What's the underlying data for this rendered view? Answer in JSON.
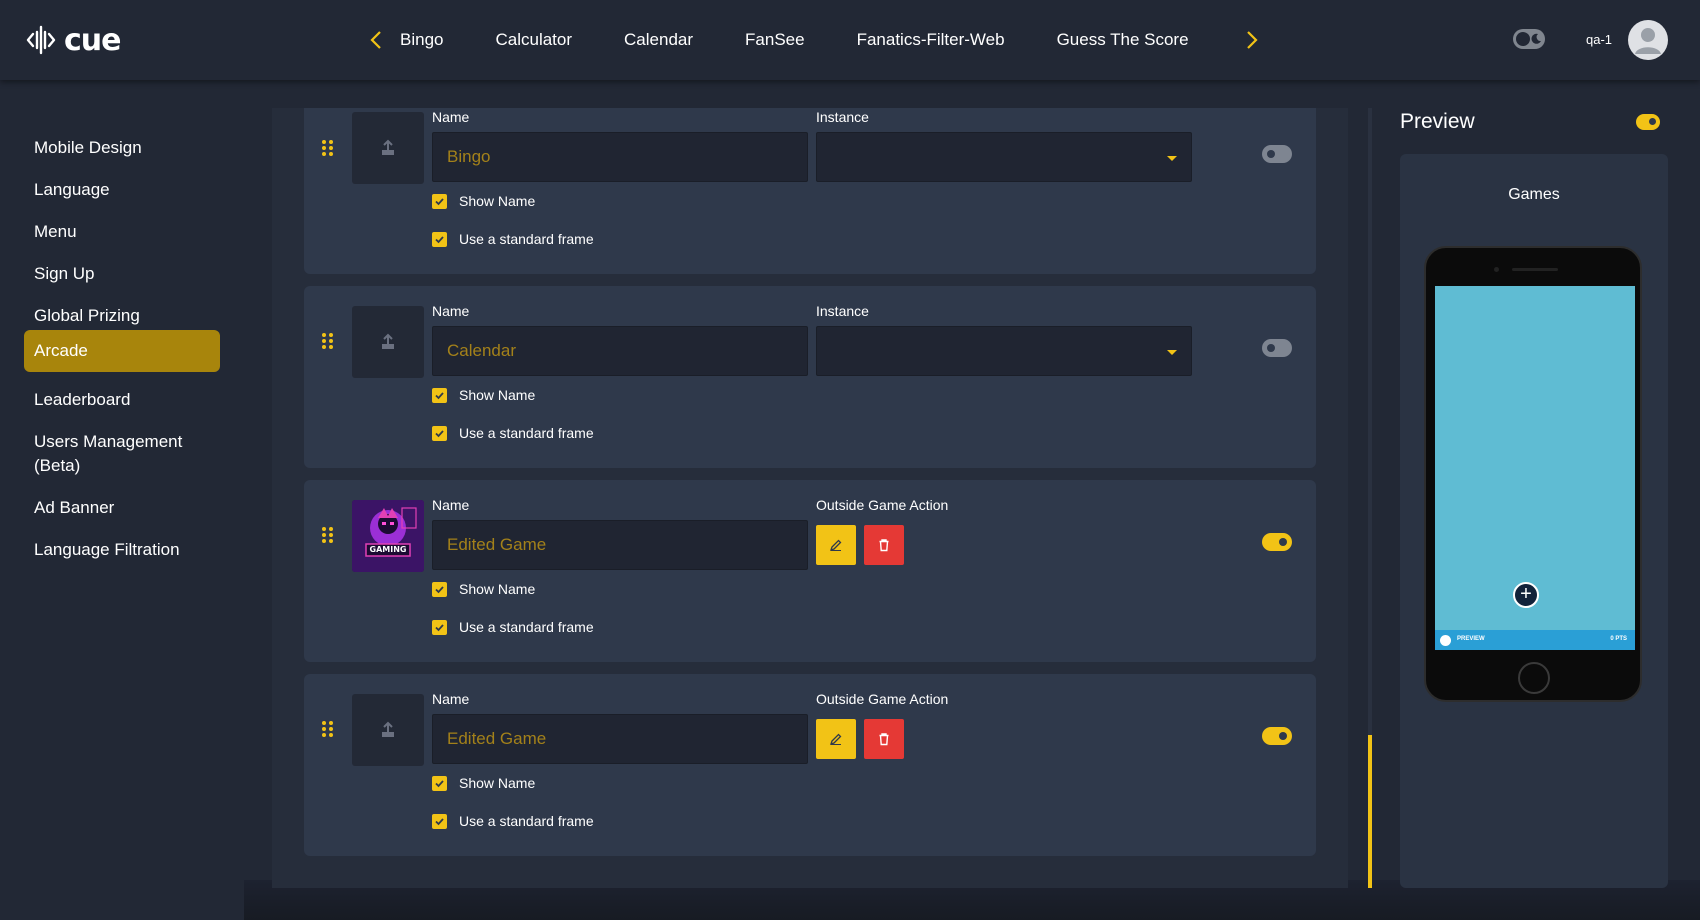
{
  "app": {
    "logo_text": "cue",
    "username": "qa-1"
  },
  "nav": {
    "tabs": [
      "Bingo",
      "Calculator",
      "Calendar",
      "FanSee",
      "Fanatics-Filter-Web",
      "Guess The Score"
    ]
  },
  "sidebar": {
    "items": [
      {
        "label": "Mobile Design",
        "active": false
      },
      {
        "label": "Language",
        "active": false
      },
      {
        "label": "Menu",
        "active": false
      },
      {
        "label": "Sign Up",
        "active": false
      },
      {
        "label": "Global Prizing",
        "active": false
      },
      {
        "label": "Arcade",
        "active": true
      },
      {
        "label": "Leaderboard",
        "active": false
      },
      {
        "label": "Users Management (Beta)",
        "active": false
      },
      {
        "label": "Ad Banner",
        "active": false
      },
      {
        "label": "Language Filtration",
        "active": false
      }
    ]
  },
  "games": [
    {
      "name_label": "Name",
      "name_value": "Bingo",
      "second_label": "Instance",
      "second_type": "select",
      "show_name": "Show Name",
      "standard_frame": "Use a standard frame",
      "show_name_checked": true,
      "standard_frame_checked": true,
      "enabled": false,
      "thumbnail": "upload-icon"
    },
    {
      "name_label": "Name",
      "name_value": "Calendar",
      "second_label": "Instance",
      "second_type": "select",
      "show_name": "Show Name",
      "standard_frame": "Use a standard frame",
      "show_name_checked": true,
      "standard_frame_checked": true,
      "enabled": false,
      "thumbnail": "upload-icon"
    },
    {
      "name_label": "Name",
      "name_value": "Edited Game",
      "second_label": "Outside Game Action",
      "second_type": "actions",
      "show_name": "Show Name",
      "standard_frame": "Use a standard frame",
      "show_name_checked": true,
      "standard_frame_checked": true,
      "enabled": true,
      "thumbnail": "gaming-logo-image",
      "thumbnail_text": "GAMING"
    },
    {
      "name_label": "Name",
      "name_value": "Edited Game",
      "second_label": "Outside Game Action",
      "second_type": "actions",
      "show_name": "Show Name",
      "standard_frame": "Use a standard frame",
      "show_name_checked": true,
      "standard_frame_checked": true,
      "enabled": true,
      "thumbnail": "upload-icon"
    }
  ],
  "preview": {
    "title": "Preview",
    "enabled": true,
    "heading": "Games",
    "phone_left_label": "PREVIEW",
    "phone_right_label": "0 PTS",
    "phone_action": "+"
  },
  "colors": {
    "accent": "#f2c316",
    "sidebar_active": "#a8850c",
    "delete": "#e53935",
    "phone_screen": "#5fbcd3"
  }
}
